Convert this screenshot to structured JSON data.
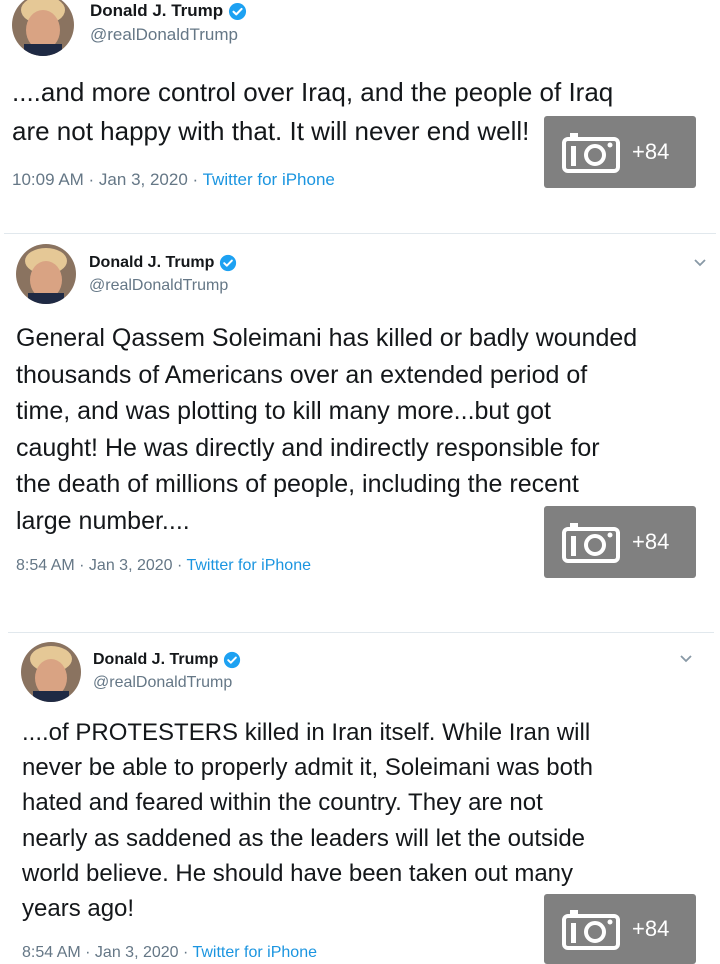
{
  "tweets": [
    {
      "name": "Donald J. Trump",
      "handle": "@realDonaldTrump",
      "text": "....and more control over Iraq, and the people of Iraq\nare not happy with that. It will never end well!",
      "timestamp": "10:09 AM · Jan 3, 2020 · ",
      "source": "Twitter for iPhone",
      "photo_count": "+84"
    },
    {
      "name": "Donald J. Trump",
      "handle": "@realDonaldTrump",
      "text": "General Qassem Soleimani has killed or badly wounded\nthousands of Americans over an extended period of\ntime, and was plotting to kill many more...but got\ncaught! He was directly and indirectly responsible for\nthe death of millions of people, including the recent\nlarge number....",
      "timestamp": "8:54 AM · Jan 3, 2020 · ",
      "source": "Twitter for iPhone",
      "photo_count": "+84"
    },
    {
      "name": "Donald J. Trump",
      "handle": "@realDonaldTrump",
      "text": "....of PROTESTERS killed in Iran itself. While Iran will\nnever be able to properly admit it, Soleimani was both\nhated and feared within the country. They are not\nnearly as saddened as the leaders will let the outside\nworld believe. He should have been taken out many\nyears ago!",
      "timestamp": "8:54 AM · Jan 3, 2020 · ",
      "source": "Twitter for iPhone",
      "photo_count": "+84"
    }
  ],
  "colors": {
    "verified": "#1da1f2",
    "link": "#1b95e0",
    "muted": "#657786"
  },
  "icons": [
    "verified-badge-icon",
    "chevron-down-icon",
    "camera-icon"
  ]
}
